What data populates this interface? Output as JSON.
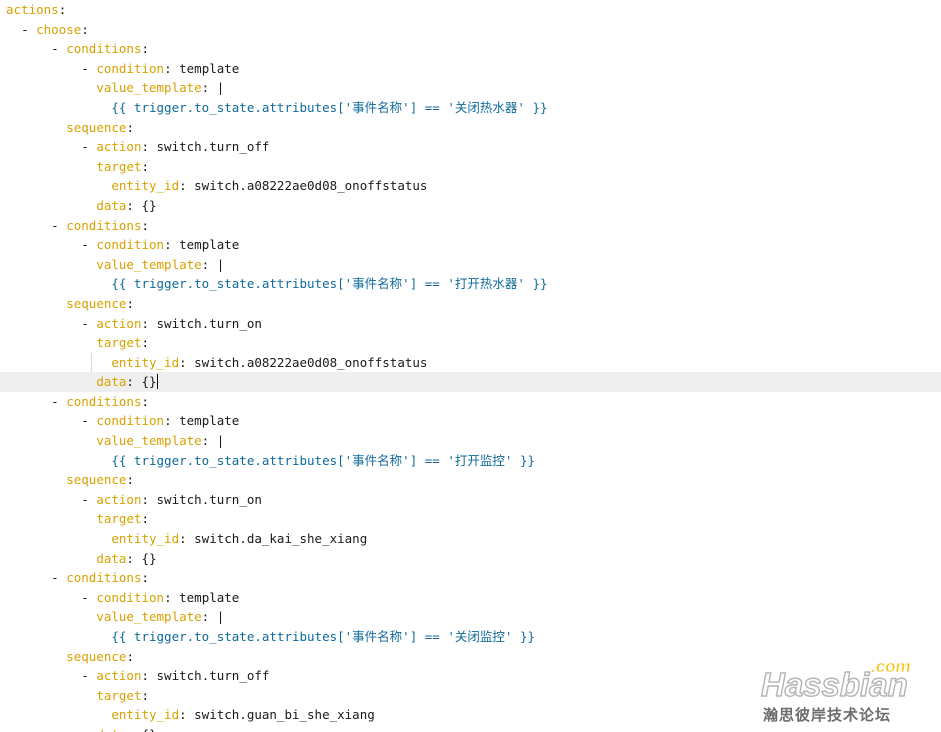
{
  "editor": {
    "lines": [
      {
        "text": "actions:",
        "indent": 0
      },
      {
        "text": "- choose:",
        "indent": 2
      },
      {
        "text": "- conditions:",
        "indent": 6
      },
      {
        "text": "- condition: template",
        "indent": 10
      },
      {
        "text": "value_template: |",
        "indent": 12
      },
      {
        "text": "{{ trigger.to_state.attributes['事件名称'] == '关闭热水器' }}",
        "indent": 14
      },
      {
        "text": "sequence:",
        "indent": 8
      },
      {
        "text": "- action: switch.turn_off",
        "indent": 10
      },
      {
        "text": "target:",
        "indent": 12
      },
      {
        "text": "entity_id: switch.a08222ae0d08_onoffstatus",
        "indent": 14
      },
      {
        "text": "data: {}",
        "indent": 12
      },
      {
        "text": "- conditions:",
        "indent": 6
      },
      {
        "text": "- condition: template",
        "indent": 10
      },
      {
        "text": "value_template: |",
        "indent": 12
      },
      {
        "text": "{{ trigger.to_state.attributes['事件名称'] == '打开热水器' }}",
        "indent": 14
      },
      {
        "text": "sequence:",
        "indent": 8
      },
      {
        "text": "- action: switch.turn_on",
        "indent": 10
      },
      {
        "text": "target:",
        "indent": 12
      },
      {
        "text": "entity_id: switch.a08222ae0d08_onoffstatus",
        "indent": 14
      },
      {
        "text": "data: {}",
        "indent": 12,
        "current": true
      },
      {
        "text": "- conditions:",
        "indent": 6
      },
      {
        "text": "- condition: template",
        "indent": 10
      },
      {
        "text": "value_template: |",
        "indent": 12
      },
      {
        "text": "{{ trigger.to_state.attributes['事件名称'] == '打开监控' }}",
        "indent": 14
      },
      {
        "text": "sequence:",
        "indent": 8
      },
      {
        "text": "- action: switch.turn_on",
        "indent": 10
      },
      {
        "text": "target:",
        "indent": 12
      },
      {
        "text": "entity_id: switch.da_kai_she_xiang",
        "indent": 14
      },
      {
        "text": "data: {}",
        "indent": 12
      },
      {
        "text": "- conditions:",
        "indent": 6
      },
      {
        "text": "- condition: template",
        "indent": 10
      },
      {
        "text": "value_template: |",
        "indent": 12
      },
      {
        "text": "{{ trigger.to_state.attributes['事件名称'] == '关闭监控' }}",
        "indent": 14
      },
      {
        "text": "sequence:",
        "indent": 8
      },
      {
        "text": "- action: switch.turn_off",
        "indent": 10
      },
      {
        "text": "target:",
        "indent": 12
      },
      {
        "text": "entity_id: switch.guan_bi_she_xiang",
        "indent": 14
      },
      {
        "text": "data: {}",
        "indent": 12
      }
    ]
  },
  "watermark": {
    "logo_text": "Hassbian",
    "logo_suffix": ".com",
    "caption": "瀚思彼岸技术论坛"
  },
  "colors": {
    "key": "#d7a100",
    "string": "#0f6a9a",
    "text": "#1a1a1a",
    "current_line": "#efefef",
    "logo_gray": "#b4b4b4",
    "logo_suffix": "#f2c318"
  }
}
